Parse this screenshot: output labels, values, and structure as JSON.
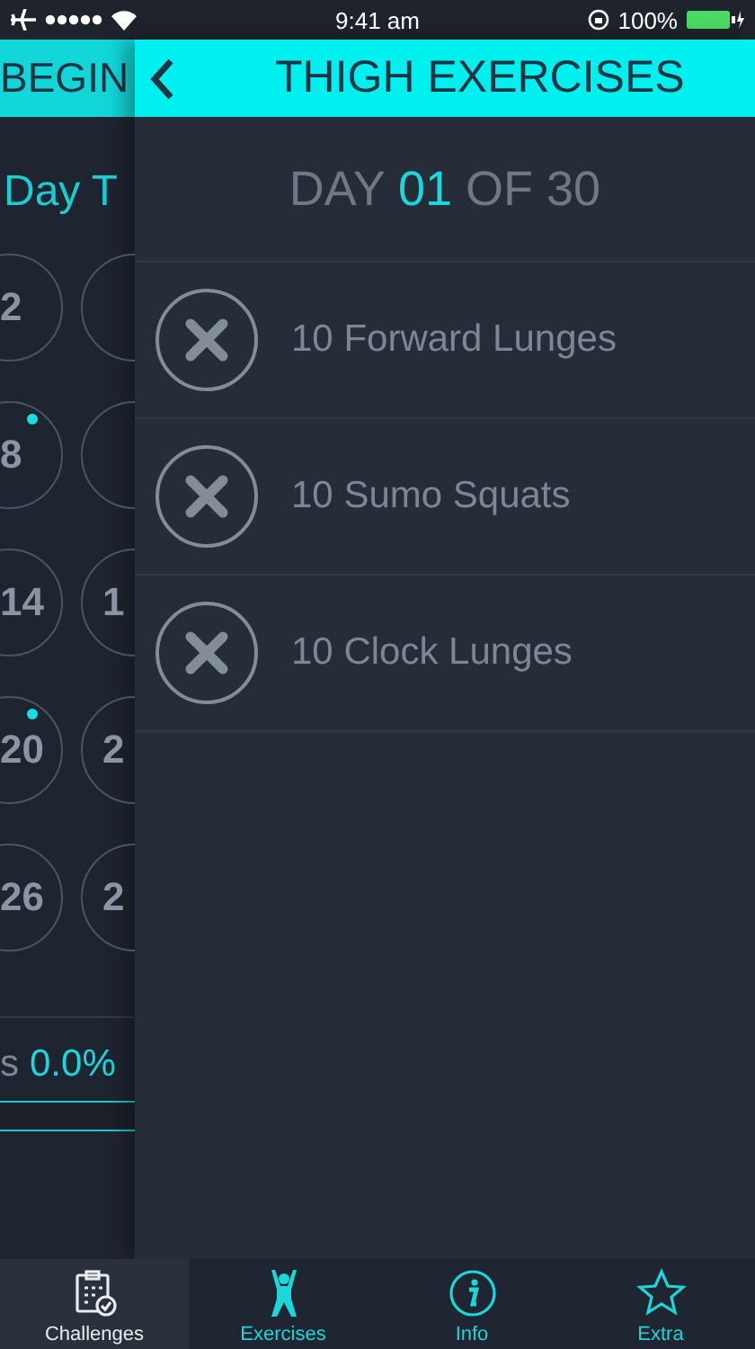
{
  "status_bar": {
    "time": "9:41 am",
    "battery": "100%"
  },
  "back_screen": {
    "title": "BEGIN",
    "subtitle": "Day T",
    "days": [
      {
        "label": "2",
        "marked": false
      },
      {
        "marked": false
      },
      {
        "label": "8",
        "marked": true
      },
      {
        "marked": false
      },
      {
        "label": "14",
        "marked": false
      },
      {
        "label": "1",
        "marked": false
      },
      {
        "label": "20",
        "marked": true
      },
      {
        "label": "2",
        "marked": false
      },
      {
        "label": "26",
        "marked": false
      },
      {
        "label": "2",
        "marked": false
      }
    ],
    "progress_label": "s",
    "progress_value": "0.0%",
    "progress": {
      "level": 0
    }
  },
  "screen": {
    "title": "THIGH EXERCISES",
    "day_prefix": "DAY",
    "day_number": "01",
    "day_suffix": "OF 30",
    "exercises": [
      {
        "name": "10 Forward Lunges",
        "done": false
      },
      {
        "name": "10 Sumo Squats",
        "done": false
      },
      {
        "name": "10 Clock Lunges",
        "done": false
      }
    ]
  },
  "tabs": [
    {
      "label": "Challenges",
      "kind": "calendar",
      "selected": true
    },
    {
      "label": "Exercises",
      "kind": "person",
      "selected": false
    },
    {
      "label": "Info",
      "kind": "info",
      "selected": false
    },
    {
      "label": "Extra",
      "kind": "star",
      "selected": false
    }
  ]
}
